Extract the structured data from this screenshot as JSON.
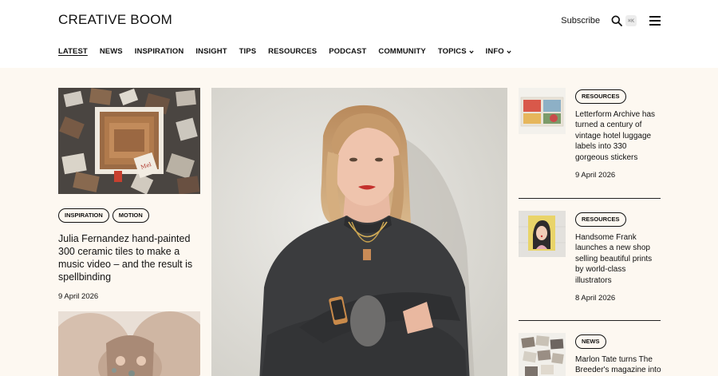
{
  "header": {
    "logo": "CREATIVE BOOM",
    "subscribe": "Subscribe",
    "search_shortcut": "⌘K",
    "search_icon": "search-icon",
    "menu_icon": "menu-icon"
  },
  "nav": {
    "items": [
      {
        "label": "LATEST",
        "active": true
      },
      {
        "label": "NEWS"
      },
      {
        "label": "INSPIRATION"
      },
      {
        "label": "INSIGHT"
      },
      {
        "label": "TIPS"
      },
      {
        "label": "RESOURCES"
      },
      {
        "label": "PODCAST"
      },
      {
        "label": "COMMUNITY"
      },
      {
        "label": "TOPICS",
        "dropdown": true
      },
      {
        "label": "INFO",
        "dropdown": true
      }
    ]
  },
  "left_article": {
    "tags": [
      "INSPIRATION",
      "MOTION"
    ],
    "title": "Julia Fernandez hand-painted 300 ceramic tiles to make a music video – and the result is spellbinding",
    "date": "9 April 2026"
  },
  "right_articles": [
    {
      "tag": "RESOURCES",
      "title": "Letterform Archive has turned a century of vintage hotel luggage labels into 330 gorgeous stickers",
      "date": "9 April 2026"
    },
    {
      "tag": "RESOURCES",
      "title": "Handsome Frank launches a new shop selling beautiful prints by world-class illustrators",
      "date": "8 April 2026"
    },
    {
      "tag": "NEWS",
      "title": "Marlon Tate turns The Breeder's magazine into"
    }
  ],
  "colors": {
    "page_bg": "#fdf8f1",
    "header_bg": "#ffffff",
    "text": "#111111"
  }
}
